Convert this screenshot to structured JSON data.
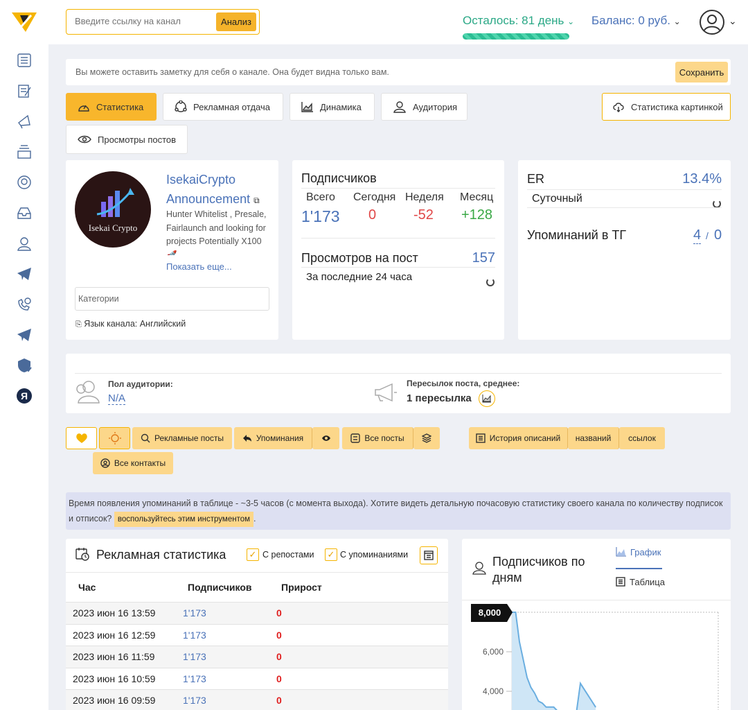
{
  "header": {
    "search_placeholder": "Введите ссылку на канал",
    "analyze_label": "Анализ",
    "remaining": "Осталось: 81 день",
    "balance": "Баланс: 0 руб."
  },
  "note": {
    "text": "Вы можете оставить заметку для себя о канале. Она будет видна только вам.",
    "save_label": "Сохранить"
  },
  "tabs": {
    "stats": "Статистика",
    "ad_return": "Рекламная отдача",
    "dynamics": "Динамика",
    "audience": "Аудитория",
    "stats_image": "Статистика картинкой",
    "post_views": "Просмотры постов"
  },
  "channel": {
    "name": "IsekaiCrypto Announcement",
    "description": "Hunter Whitelist , Presale, Fairlaunch and looking for projects Potentially X100 🚀",
    "logo_text": "Isekai Crypto",
    "show_more": "Показать еще...",
    "categories_placeholder": "Категории",
    "language": "Язык канала: Английский"
  },
  "subscribers": {
    "title": "Подписчиков",
    "cols": [
      "Всего",
      "Сегодня",
      "Неделя",
      "Месяц"
    ],
    "total": "1'173",
    "today": "0",
    "week": "-52",
    "month": "+128",
    "views_title": "Просмотров на пост",
    "views_value": "157",
    "views_sub": "За последние 24 часа"
  },
  "er": {
    "title": "ER",
    "value": "13.4%",
    "daily": "Суточный",
    "mentions_title": "Упоминаний в ТГ",
    "mentions_a": "4",
    "mentions_sep": "/",
    "mentions_b": "0"
  },
  "audience": {
    "gender_label": "Пол аудитории:",
    "gender_value": "N/A",
    "forwards_label": "Пересылок поста, среднее:",
    "forwards_value": "1 пересылка"
  },
  "actions": {
    "ad_posts": "Рекламные посты",
    "mentions": "Упоминания",
    "all_posts": "Все посты",
    "desc_history": "История описаний",
    "names": "названий",
    "links": "ссылок",
    "all_contacts": "Все контакты"
  },
  "info": {
    "text": "Время появления упоминаний в таблице - ~3-5 часов (с момента выхода). Хотите видеть детальную почасовую статистику своего канала по количеству подписок и отписок?",
    "link": "воспользуйтесь этим инструментом",
    "end": "."
  },
  "ad_stats": {
    "title": "Рекламная статистика",
    "with_reposts": "С репостами",
    "with_mentions": "С упоминаниями",
    "headers": [
      "Час",
      "Подписчиков",
      "Прирост"
    ],
    "rows": [
      {
        "hour": "2023 июн 16 13:59",
        "subs": "1'173",
        "growth": "0"
      },
      {
        "hour": "2023 июн 16 12:59",
        "subs": "1'173",
        "growth": "0"
      },
      {
        "hour": "2023 июн 16 11:59",
        "subs": "1'173",
        "growth": "0"
      },
      {
        "hour": "2023 июн 16 10:59",
        "subs": "1'173",
        "growth": "0"
      },
      {
        "hour": "2023 июн 16 09:59",
        "subs": "1'173",
        "growth": "0"
      }
    ]
  },
  "subs_by_day": {
    "title_line1": "Подписчиков по",
    "title_line2": "дням",
    "graph_tab": "График",
    "table_tab": "Таблица",
    "tooltip": "8,000"
  },
  "chart_data": {
    "type": "area",
    "title": "Подписчиков по дням",
    "yticks": [
      "8,000",
      "6,000",
      "4,000"
    ],
    "ylim": [
      2600,
      8000
    ],
    "x": [
      0,
      1,
      2,
      3,
      4,
      5,
      6,
      7,
      8,
      9,
      10,
      11,
      12,
      13,
      14,
      15,
      16,
      17,
      18,
      19,
      20,
      21,
      22
    ],
    "values": [
      8000,
      8000,
      6500,
      5600,
      4700,
      4200,
      3900,
      3500,
      3400,
      3200,
      3200,
      3200,
      3000,
      3000,
      3000,
      3000,
      3000,
      3000,
      4400,
      4100,
      3800,
      3500,
      3200
    ],
    "colors": {
      "line": "#6aaee0",
      "fill": "#cfe6f6"
    }
  }
}
